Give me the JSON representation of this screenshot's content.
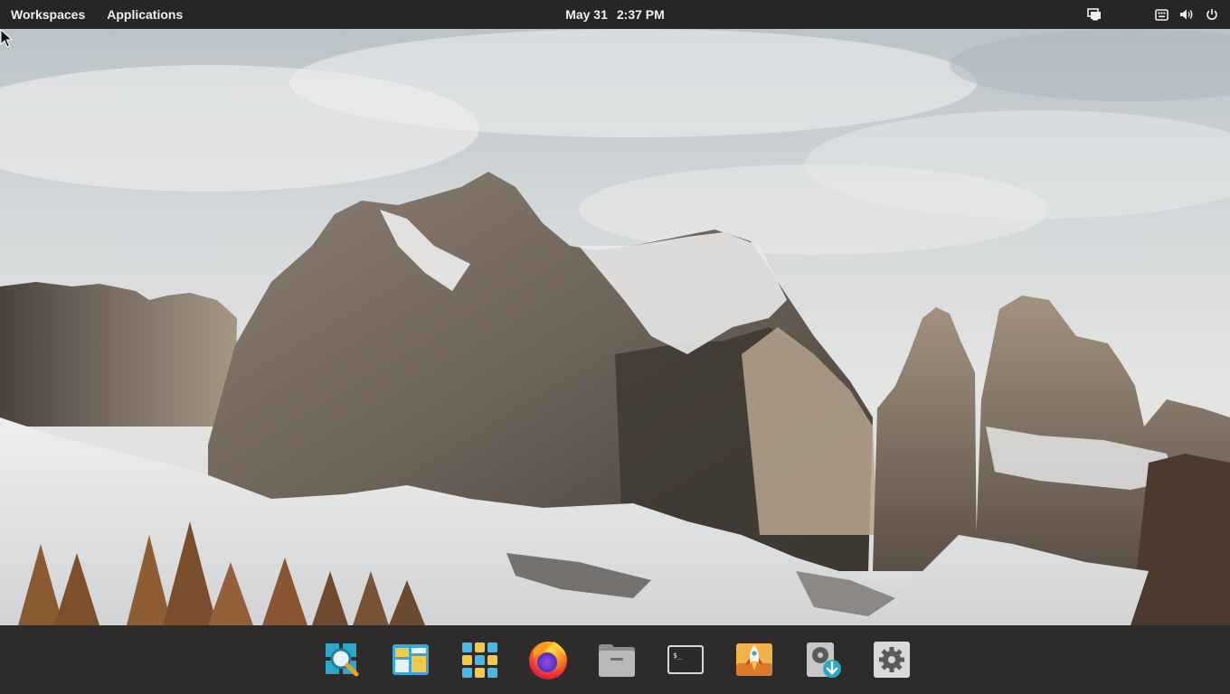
{
  "topbar": {
    "workspaces_label": "Workspaces",
    "applications_label": "Applications",
    "date": "May 31",
    "time": "2:37 PM",
    "indicators": [
      "display-icon",
      "keyboard-icon",
      "volume-icon",
      "power-icon"
    ]
  },
  "dock": {
    "items": [
      {
        "name": "search-app",
        "icon": "magnifier-icon"
      },
      {
        "name": "multitasking-view",
        "icon": "windows-icon"
      },
      {
        "name": "app-grid",
        "icon": "grid-icon"
      },
      {
        "name": "firefox",
        "icon": "firefox-icon"
      },
      {
        "name": "files",
        "icon": "folder-icon"
      },
      {
        "name": "terminal",
        "icon": "terminal-icon"
      },
      {
        "name": "launcher",
        "icon": "rocket-icon"
      },
      {
        "name": "installer",
        "icon": "disk-download-icon"
      },
      {
        "name": "settings",
        "icon": "gear-icon"
      }
    ],
    "terminal_prompt": "$_"
  },
  "colors": {
    "panel_bg": "#262626",
    "dock_bg": "#2e2c2b",
    "accent_teal": "#2aa7c9",
    "accent_yellow": "#f4c94a"
  }
}
